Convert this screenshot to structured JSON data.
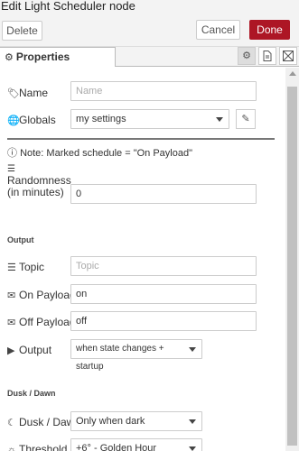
{
  "window": {
    "title": "Edit Light Scheduler node"
  },
  "toolbar": {
    "delete_label": "Delete",
    "cancel_label": "Cancel",
    "done_label": "Done"
  },
  "tabs": [
    {
      "label": "Properties",
      "icon": "gear-icon"
    }
  ],
  "form": {
    "name": {
      "label": "Name",
      "placeholder": "Name",
      "value": ""
    },
    "globals": {
      "label": "Globals",
      "value": "my settings"
    },
    "note": "Note: Marked schedule = \"On Payload\"",
    "randomness": {
      "label_line1": "Randomness",
      "label_line2": "(in minutes)",
      "value": "0"
    },
    "output_section": "Output",
    "topic": {
      "label": "Topic",
      "placeholder": "Topic",
      "value": ""
    },
    "on_payload": {
      "label": "On Payload",
      "value": "on"
    },
    "off_payload": {
      "label": "Off Payload",
      "value": "off"
    },
    "output": {
      "label": "Output",
      "value": "when state changes + startup"
    },
    "dusk_section": "Dusk / Dawn",
    "dusk_dawn": {
      "label": "Dusk / Dawn",
      "value": "Only when dark"
    },
    "threshold": {
      "label": "Threshold",
      "value": "+6° - Golden Hour"
    }
  },
  "colors": {
    "accent": "#ad1625",
    "border": "#cccccc",
    "background": "#f3f3f3"
  }
}
